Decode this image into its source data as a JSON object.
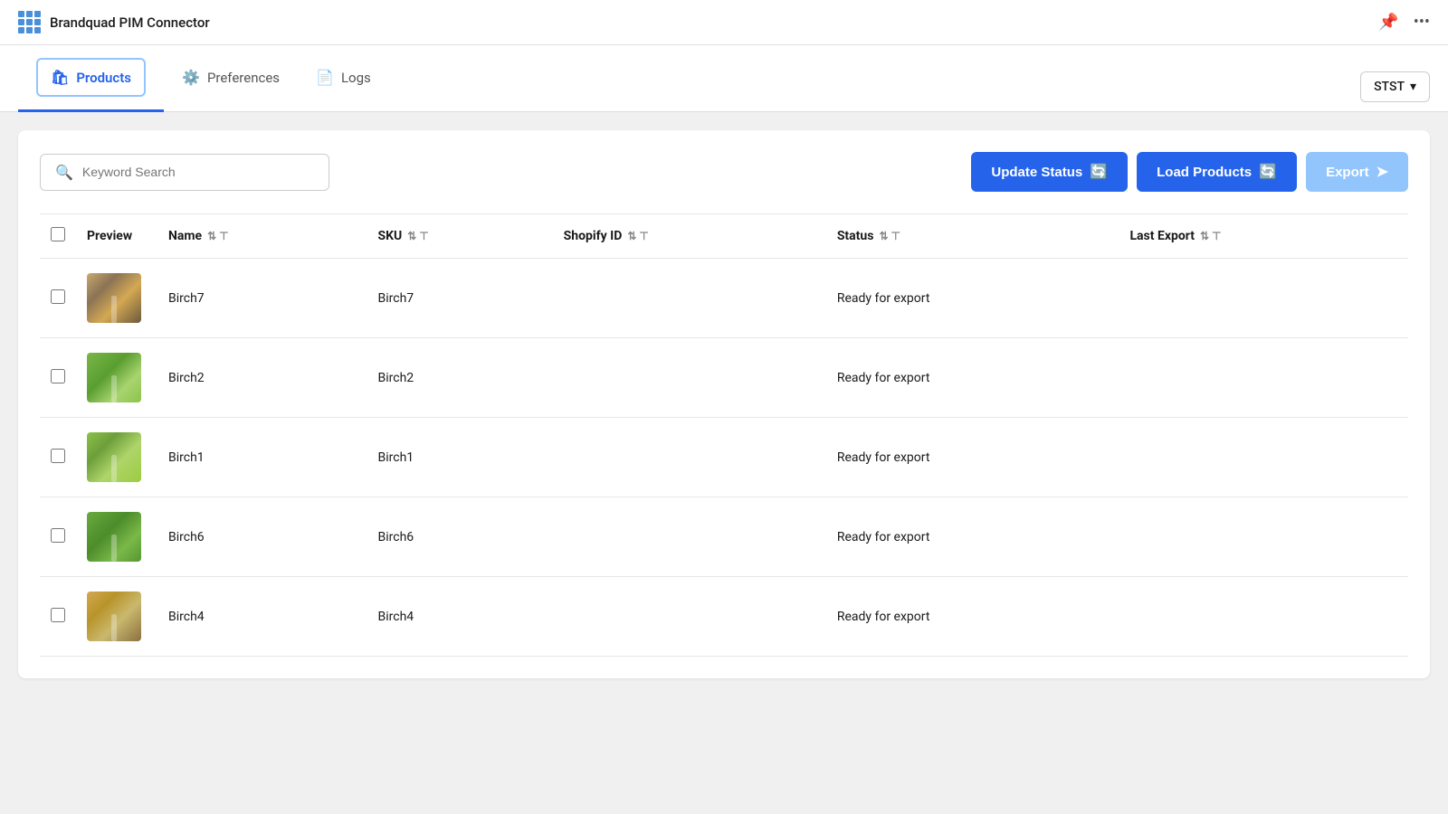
{
  "app": {
    "title": "Brandquad PIM Connector"
  },
  "nav": {
    "tabs": [
      {
        "id": "products",
        "label": "Products",
        "icon": "🛍",
        "active": true
      },
      {
        "id": "preferences",
        "label": "Preferences",
        "icon": "⚙",
        "active": false
      },
      {
        "id": "logs",
        "label": "Logs",
        "icon": "📄",
        "active": false
      }
    ],
    "store_selector": {
      "value": "STST",
      "chevron": "▾"
    }
  },
  "toolbar": {
    "search_placeholder": "Keyword Search",
    "update_status_label": "Update Status",
    "load_products_label": "Load Products",
    "export_label": "Export"
  },
  "table": {
    "columns": [
      {
        "id": "preview",
        "label": "Preview"
      },
      {
        "id": "name",
        "label": "Name"
      },
      {
        "id": "sku",
        "label": "SKU"
      },
      {
        "id": "shopify_id",
        "label": "Shopify ID"
      },
      {
        "id": "status",
        "label": "Status"
      },
      {
        "id": "last_export",
        "label": "Last Export"
      }
    ],
    "rows": [
      {
        "id": 1,
        "name": "Birch7",
        "sku": "Birch7",
        "shopify_id": "",
        "status": "Ready for export",
        "last_export": "",
        "thumb_class": "thumb-birch7"
      },
      {
        "id": 2,
        "name": "Birch2",
        "sku": "Birch2",
        "shopify_id": "",
        "status": "Ready for export",
        "last_export": "",
        "thumb_class": "thumb-birch2"
      },
      {
        "id": 3,
        "name": "Birch1",
        "sku": "Birch1",
        "shopify_id": "",
        "status": "Ready for export",
        "last_export": "",
        "thumb_class": "thumb-birch1"
      },
      {
        "id": 4,
        "name": "Birch6",
        "sku": "Birch6",
        "shopify_id": "",
        "status": "Ready for export",
        "last_export": "",
        "thumb_class": "thumb-birch6"
      },
      {
        "id": 5,
        "name": "Birch4",
        "sku": "Birch4",
        "shopify_id": "",
        "status": "Ready for export",
        "last_export": "",
        "thumb_class": "thumb-birch4"
      }
    ]
  }
}
